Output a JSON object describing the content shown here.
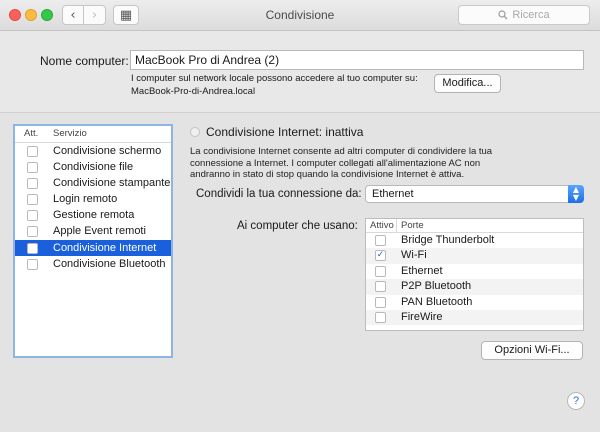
{
  "window": {
    "title": "Condivisione",
    "search_placeholder": "Ricerca",
    "nav_back": "‹",
    "nav_forward": "›",
    "grid_glyph": "▦"
  },
  "computer": {
    "name_label": "Nome computer:",
    "name_value": "MacBook Pro di Andrea (2)",
    "info_line1": "I computer sul network locale possono accedere al tuo computer su:",
    "info_line2": "MacBook-Pro-di-Andrea.local",
    "edit_button": "Modifica..."
  },
  "services": {
    "col_active": "Att.",
    "col_service": "Servizio",
    "selected_color": "#1a5fdb",
    "items": [
      {
        "label": "Condivisione schermo"
      },
      {
        "label": "Condivisione file"
      },
      {
        "label": "Condivisione stampante"
      },
      {
        "label": "Login remoto"
      },
      {
        "label": "Gestione remota"
      },
      {
        "label": "Apple Event remoti"
      },
      {
        "label": "Condivisione Internet",
        "selected": true
      },
      {
        "label": "Condivisione Bluetooth"
      }
    ]
  },
  "internet_sharing": {
    "status": "Condivisione Internet: inattiva",
    "description_line1": "La condivisione Internet consente ad altri computer di condividere la tua",
    "description_line2": "connessione a Internet. I computer collegati all'alimentazione AC non",
    "description_line3": "andranno in stato di stop quando la condivisione Internet è attiva.",
    "share_from_label": "Condividi la tua connessione da:",
    "share_from_value": "Ethernet",
    "to_computers_label": "Ai computer che usano:",
    "ports_col_active": "Attivo",
    "ports_col_ports": "Porte",
    "ports": [
      {
        "label": "Bridge Thunderbolt",
        "checked": false
      },
      {
        "label": "Wi-Fi",
        "checked": true
      },
      {
        "label": "Ethernet",
        "checked": false
      },
      {
        "label": "P2P Bluetooth",
        "checked": false
      },
      {
        "label": "PAN Bluetooth",
        "checked": false
      },
      {
        "label": "FireWire",
        "checked": false
      }
    ],
    "wifi_options_button": "Opzioni Wi-Fi..."
  },
  "help": "?"
}
